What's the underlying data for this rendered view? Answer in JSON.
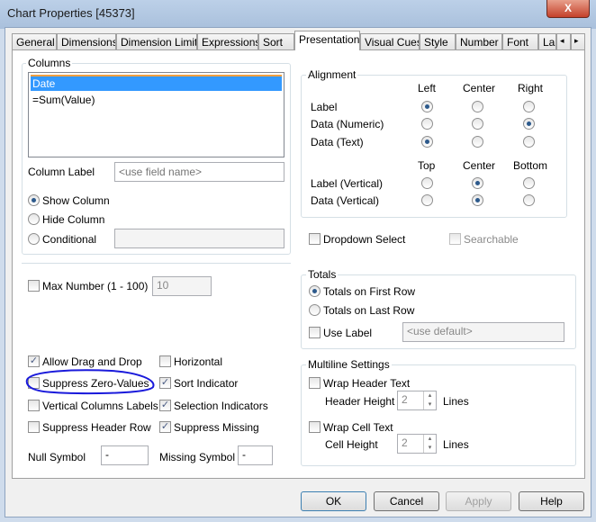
{
  "window": {
    "title": "Chart Properties [45373]",
    "close": "X"
  },
  "tabs": [
    "General",
    "Dimensions",
    "Dimension Limits",
    "Expressions",
    "Sort",
    "Presentation",
    "Visual Cues",
    "Style",
    "Number",
    "Font",
    "La"
  ],
  "tab_scroll": {
    "left": "◂",
    "right": "▸"
  },
  "columns": {
    "label": "Columns",
    "items": [
      "Date",
      "=Sum(Value)"
    ],
    "column_label": "Column Label",
    "column_label_placeholder": "<use field name>",
    "show": "Show Column",
    "hide": "Hide Column",
    "conditional": "Conditional"
  },
  "alignment": {
    "label": "Alignment",
    "h_headers": [
      "Left",
      "Center",
      "Right"
    ],
    "v_headers": [
      "Top",
      "Center",
      "Bottom"
    ],
    "rows": [
      "Label",
      "Data (Numeric)",
      "Data (Text)"
    ],
    "vrows": [
      "Label (Vertical)",
      "Data (Vertical)"
    ]
  },
  "dropdown_select": "Dropdown Select",
  "searchable": "Searchable",
  "max_number": {
    "label": "Max Number (1 - 100)",
    "value": "10"
  },
  "totals": {
    "label": "Totals",
    "first": "Totals on First Row",
    "last": "Totals on Last Row",
    "use_label": "Use Label",
    "placeholder": "<use default>"
  },
  "options": {
    "allow_drag": "Allow Drag and Drop",
    "suppress_zero": "Suppress Zero-Values",
    "vertical_labels": "Vertical Columns Labels",
    "suppress_header": "Suppress Header Row",
    "horizontal": "Horizontal",
    "sort_indicator": "Sort Indicator",
    "selection_indicators": "Selection Indicators",
    "suppress_missing": "Suppress Missing"
  },
  "null_symbol": {
    "label": "Null Symbol",
    "value": "-"
  },
  "missing_symbol": {
    "label": "Missing Symbol",
    "value": "-"
  },
  "multiline": {
    "label": "Multiline Settings",
    "wrap_header": "Wrap Header Text",
    "header_height": "Header Height",
    "header_value": "2",
    "wrap_cell": "Wrap Cell Text",
    "cell_height": "Cell Height",
    "cell_value": "2",
    "lines": "Lines"
  },
  "buttons": {
    "ok": "OK",
    "cancel": "Cancel",
    "apply": "Apply",
    "help": "Help"
  },
  "check": "✓"
}
